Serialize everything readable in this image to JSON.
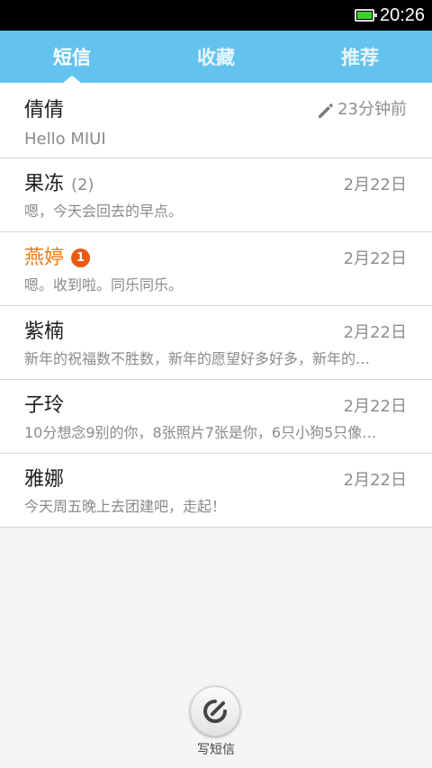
{
  "status_bar": {
    "time": "20:26",
    "battery_color": "#3bd12e"
  },
  "tabs": [
    {
      "label": "短信",
      "active": true
    },
    {
      "label": "收藏",
      "active": false
    },
    {
      "label": "推荐",
      "active": false
    }
  ],
  "accent_color": "#63c3ee",
  "unread_color": "#f07a14",
  "conversations": [
    {
      "name": "倩倩",
      "count": "",
      "badge": "",
      "date": "23分钟前",
      "draft_icon": "pencil-icon",
      "preview": "Hello MIUI"
    },
    {
      "name": "果冻",
      "count": "(2)",
      "badge": "",
      "date": "2月22日",
      "preview": "嗯，今天会回去的早点。"
    },
    {
      "name": "燕婷",
      "count": "",
      "badge": "1",
      "date": "2月22日",
      "preview": "嗯。收到啦。同乐同乐。"
    },
    {
      "name": "紫楠",
      "count": "",
      "badge": "",
      "date": "2月22日",
      "preview": "新年的祝福数不胜数，新年的愿望好多好多，新年的…"
    },
    {
      "name": "子玲",
      "count": "",
      "badge": "",
      "date": "2月22日",
      "preview": "10分想念9别的你，8张照片7张是你，6只小狗5只像…"
    },
    {
      "name": "雅娜",
      "count": "",
      "badge": "",
      "date": "2月22日",
      "preview": "今天周五晚上去团建吧，走起！"
    }
  ],
  "compose": {
    "label": "写短信",
    "icon": "compose-icon"
  }
}
